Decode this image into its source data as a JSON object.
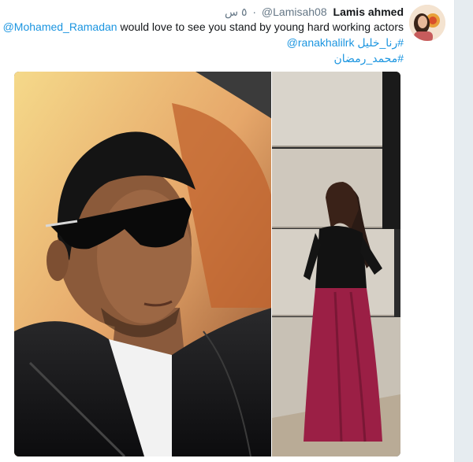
{
  "tweet": {
    "author_name": "Lamis ahmed",
    "author_handle": "@Lamisah08",
    "separator": "·",
    "timestamp": "٥ س",
    "mention": "@Mohamed_Ramadan",
    "body_text": "would love to see you stand by young hard working actors",
    "hashtag_1": "#رنا_خليل",
    "mention_2": "@ranakhalilrk",
    "hashtag_2": "#محمد_رمضان"
  },
  "colors": {
    "link": "#1b95e0",
    "text": "#14171a",
    "muted": "#657786"
  }
}
